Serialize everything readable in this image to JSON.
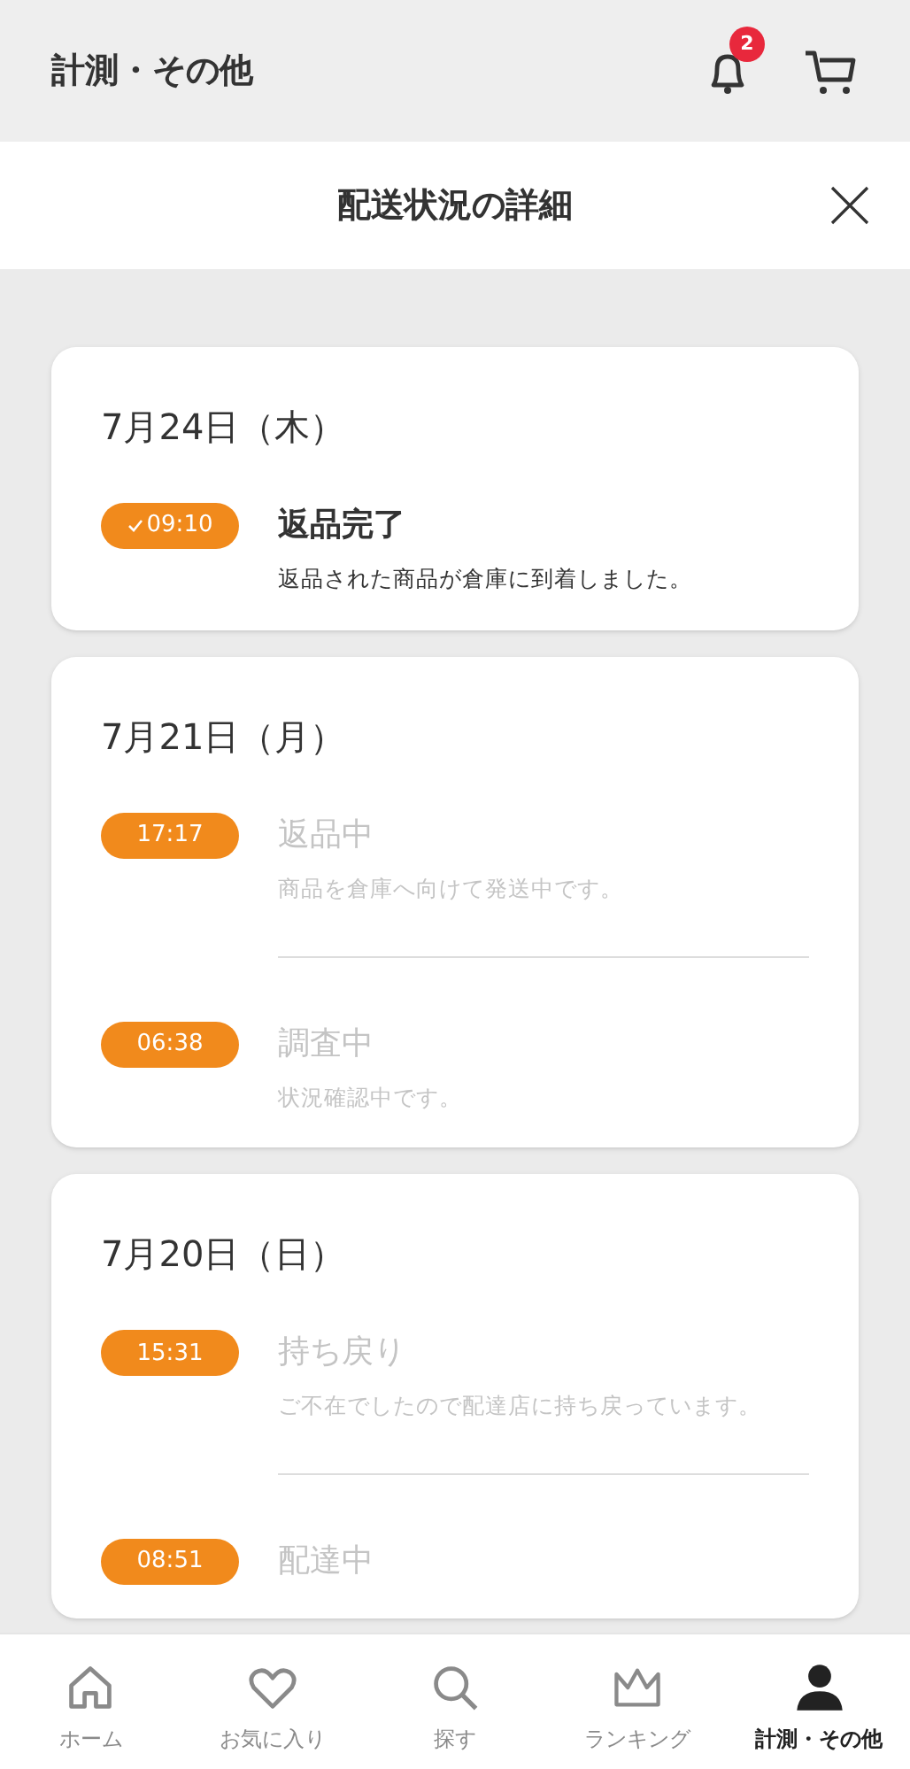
{
  "header": {
    "title": "計測・その他",
    "notification_count": "2"
  },
  "modal": {
    "title": "配送状況の詳細"
  },
  "days": [
    {
      "date": "7月24日（木）",
      "events": [
        {
          "time": "09:10",
          "title": "返品完了",
          "description": "返品された商品が倉庫に到着しました。",
          "done": true
        }
      ]
    },
    {
      "date": "7月21日（月）",
      "events": [
        {
          "time": "17:17",
          "title": "返品中",
          "description": "商品を倉庫へ向けて発送中です。",
          "done": false
        },
        {
          "time": "06:38",
          "title": "調査中",
          "description": "状況確認中です。",
          "done": false
        }
      ]
    },
    {
      "date": "7月20日（日）",
      "events": [
        {
          "time": "15:31",
          "title": "持ち戻り",
          "description": "ご不在でしたので配達店に持ち戻っています。",
          "done": false
        },
        {
          "time": "08:51",
          "title": "配達中",
          "done": false
        }
      ]
    }
  ],
  "tab_bar": [
    {
      "kind": "home",
      "label": "ホーム",
      "selected": false
    },
    {
      "kind": "heart",
      "label": "お気に入り",
      "selected": false
    },
    {
      "kind": "search",
      "label": "探す",
      "selected": false
    },
    {
      "kind": "crown",
      "label": "ランキング",
      "selected": false
    },
    {
      "kind": "person",
      "label": "計測・その他",
      "selected": true
    }
  ]
}
